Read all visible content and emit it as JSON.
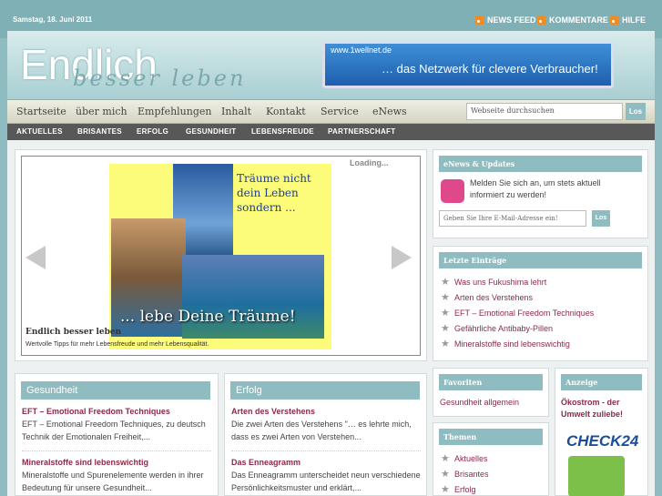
{
  "top": {
    "date": "Samstag, 18. Juni 2011",
    "links": [
      "NEWS FEED",
      "KOMMENTARE",
      "HILFE"
    ]
  },
  "header": {
    "logo_main": "Endlich",
    "logo_sub": "besser leben",
    "banner_url": "www.1wellnet.de",
    "banner_slogan": "… das Netzwerk für clevere Verbraucher!"
  },
  "nav": {
    "items": [
      "Startseite",
      "über mich",
      "Empfehlungen",
      "Inhalt",
      "Kontakt",
      "Service",
      "eNews"
    ],
    "search_placeholder": "Webseite durchsuchen",
    "search_button": "Los"
  },
  "subnav": {
    "items": [
      "AKTUELLES",
      "BRISANTES",
      "ERFOLG",
      "GESUNDHEIT",
      "LEBENSFREUDE",
      "PARTNERSCHAFT"
    ]
  },
  "slider": {
    "loading": "Loading...",
    "image_text": "Träume nicht dein Leben sondern ...",
    "image_caption": "... lebe Deine Träume!",
    "title": "Endlich besser leben",
    "subtitle": "Wertvolle Tipps für mehr Lebensfreude und mehr Lebensqualität."
  },
  "enews": {
    "title": "eNews & Updates",
    "text": "Melden Sie sich an, um stets aktuell informiert zu werden!",
    "placeholder": "Geben Sie Ihre E-Mail-Adresse ein!",
    "button": "Los"
  },
  "recent": {
    "title": "Letzte Einträge",
    "items": [
      "Was uns Fukushima lehrt",
      "Arten des Verstehens",
      "EFT – Emotional Freedom Techniques",
      "Gefährliche Antibaby-Pillen",
      "Mineralstoffe sind lebenswichtig"
    ]
  },
  "gesundheit": {
    "title": "Gesundheit",
    "posts": [
      {
        "title": "EFT – Emotional Freedom Techniques",
        "excerpt": "EFT – Emotional Freedom Techniques, zu deutsch Technik der Emotionalen Freiheit,..."
      },
      {
        "title": "Mineralstoffe sind lebenswichtig",
        "excerpt": "Mineralstoffe und Spurenelemente werden in ihrer Bedeutung für unsere Gesundheit..."
      }
    ]
  },
  "erfolg": {
    "title": "Erfolg",
    "posts": [
      {
        "title": "Arten des Verstehens",
        "excerpt": "Die zwei Arten des Verstehens \"… es lehrte mich, dass es zwei Arten von Verstehen..."
      },
      {
        "title": "Das Enneagramm",
        "excerpt": "Das Enneagramm unterscheidet neun verschiedene Persönlichkeitsmuster und erklärt,..."
      }
    ]
  },
  "favoriten": {
    "title": "Favoriten",
    "items": [
      "Gesundheit allgemein"
    ]
  },
  "themen": {
    "title": "Themen",
    "items": [
      "Aktuelles",
      "Brisantes",
      "Erfolg"
    ]
  },
  "anzeige": {
    "title": "Anzeige",
    "headline": "Ökostrom - der Umwelt zuliebe!",
    "brand": "CHECK24"
  },
  "colors": {
    "accent": "#8fbcc0",
    "link": "#8b2a46",
    "nav_dark": "#585858"
  }
}
